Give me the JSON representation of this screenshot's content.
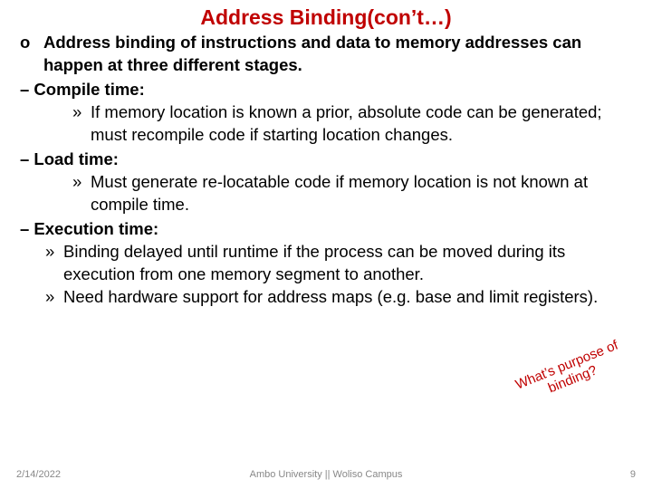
{
  "title": "Address Binding(con’t…)",
  "intro_bullet": "o",
  "intro": "Address binding of instructions and data to memory addresses can happen at three different stages.",
  "stage1_head": "– Compile time:",
  "stage1_marker": "»",
  "stage1_detail": "If memory location is known a prior, absolute code can be generated; must recompile code if starting location changes.",
  "stage2_head": "– Load time:",
  "stage2_marker": "»",
  "stage2_detail": "Must generate re-locatable code if memory location is not known at compile time.",
  "stage3_head": "– Execution time:",
  "stage3a_marker": "»",
  "stage3a_detail": "Binding delayed until runtime if the process  can be moved  during its execution from one memory segment to another.",
  "stage3b_marker": "»",
  "stage3b_detail": "Need hardware support for  address maps (e.g. base and limit registers).",
  "callout": "What’s purpose of\nbinding?",
  "footer": {
    "date": "2/14/2022",
    "center": "Ambo University || Woliso Campus",
    "page": "9"
  }
}
